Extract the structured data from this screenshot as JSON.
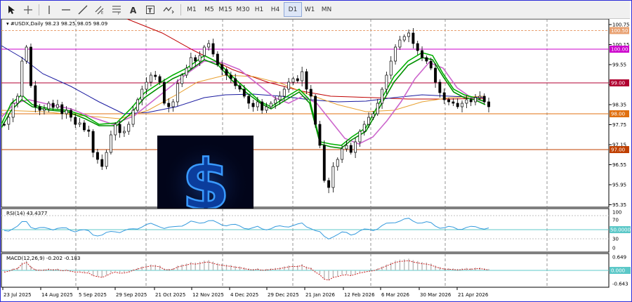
{
  "toolbar": {
    "timeframes": [
      "M1",
      "M5",
      "M15",
      "M30",
      "H1",
      "H4",
      "D1",
      "W1",
      "MN"
    ],
    "active_timeframe": "D1",
    "tools": [
      "cursor-icon",
      "crosshair-icon",
      "vertical-line-icon",
      "horizontal-line-icon",
      "trendline-icon",
      "equidistant-channel-icon",
      "fibonacci-icon",
      "text-icon",
      "text-label-icon",
      "shapes-icon"
    ]
  },
  "main_chart": {
    "symbol_header": "#USDX,Daily",
    "ohlc": "98.23 98.25 98.05 98.09",
    "price_ticks": [
      "100.75",
      "100.15",
      "99.55",
      "98.95",
      "98.35",
      "97.75",
      "97.15",
      "96.55",
      "95.95",
      "95.35"
    ],
    "level_labels": [
      {
        "text": "100.50",
        "color": "#e8a070",
        "text_color": "#ffffff"
      },
      {
        "text": "100.00",
        "color": "#cc00cc",
        "text_color": "#ffffff"
      },
      {
        "text": "99.00",
        "color": "#b00030",
        "text_color": "#ffffff"
      },
      {
        "text": "98.00",
        "color": "#e07010",
        "text_color": "#ffffff"
      },
      {
        "text": "97.00",
        "color": "#c04000",
        "text_color": "#ffffff"
      }
    ]
  },
  "rsi": {
    "label": "RSI(14) 43.4377",
    "ticks": [
      "100",
      "70",
      "50.0000",
      "30",
      "0"
    ]
  },
  "macd": {
    "label": "MACD(12,26,9) -0.202 -0.183",
    "ticks": [
      "0.649",
      "0.000",
      "-0.643"
    ]
  },
  "date_labels": [
    "23 Jul 2025",
    "14 Aug 2025",
    "5 Sep 2025",
    "29 Sep 2025",
    "21 Oct 2025",
    "12 Nov 2025",
    "4 Dec 2025",
    "29 Dec 2025",
    "21 Jan 2026",
    "12 Feb 2026",
    "6 Mar 2026",
    "30 Mar 2026",
    "21 Apr 2026"
  ],
  "overlay_image": {
    "symbol": "$",
    "background": "#02051a",
    "glow": "#2f8cff"
  },
  "colors": {
    "bull": "#000000",
    "bear": "#000000",
    "ma_fast": "#00b000",
    "ma_slow": "#009000",
    "ma_purple": "#cc66cc",
    "ma_red": "#c00000",
    "ma_orange": "#e8a030",
    "ma_blue": "#1a1aa0",
    "rsi_line": "#3399dd"
  }
}
